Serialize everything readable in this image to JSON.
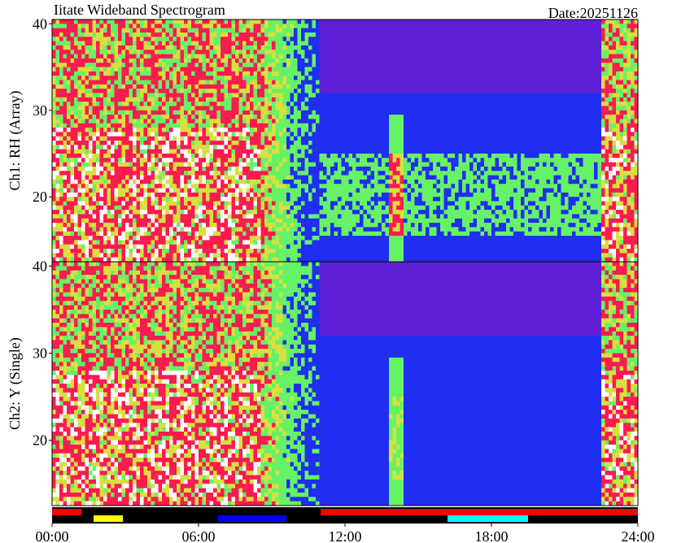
{
  "title": "Iitate Wideband Spectrogram",
  "date": "Date:20251126",
  "chart_data": {
    "type": "heatmap",
    "x_range_hours": [
      0,
      24
    ],
    "x_ticks": [
      "00:00",
      "06:00",
      "12:00",
      "18:00",
      "24:00"
    ],
    "panels": [
      {
        "name": "ch1",
        "ylabel": "Ch1: RH (Array)",
        "y_range": [
          12.5,
          40.5
        ],
        "y_ticks": [
          20,
          30,
          40
        ]
      },
      {
        "name": "ch2",
        "ylabel": "Ch2: Y (Single)",
        "y_range": [
          12.5,
          40.5
        ],
        "y_ticks": [
          20,
          30,
          40
        ]
      }
    ],
    "status_bar": {
      "background": "#000000",
      "segments": [
        {
          "row": "top",
          "start": 0.0,
          "end": 1.2,
          "color": "#ff0000"
        },
        {
          "row": "top",
          "start": 11.0,
          "end": 24.0,
          "color": "#ff0000"
        },
        {
          "row": "bottom",
          "start": 1.7,
          "end": 2.9,
          "color": "#ffff00"
        },
        {
          "row": "bottom",
          "start": 6.8,
          "end": 9.6,
          "color": "#0000ff"
        },
        {
          "row": "bottom",
          "start": 16.2,
          "end": 19.5,
          "color": "#00ffff"
        }
      ]
    },
    "colors": {
      "white": "#ffffff",
      "red": "#ff1a50",
      "green": "#66f266",
      "yellow": "#d6e040",
      "blue": "#1f2ef0",
      "purple": "#5f1fd6"
    }
  }
}
